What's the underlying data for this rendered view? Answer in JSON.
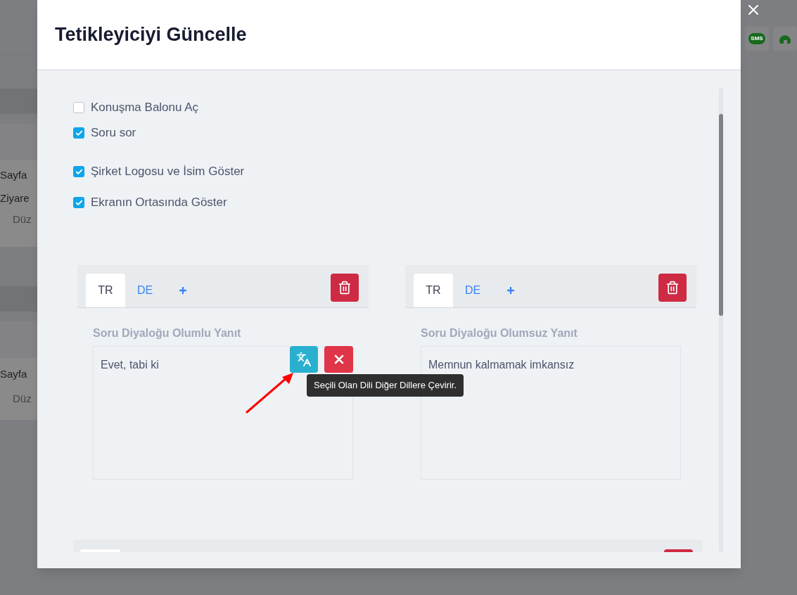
{
  "background": {
    "left_texts": [
      "Sayfa",
      "Ziyare",
      "Düz",
      "Sayfa",
      "Düz"
    ],
    "sms_label": "SMS"
  },
  "modal": {
    "title": "Tetikleyiciyi Güncelle"
  },
  "options": [
    {
      "label": "Konuşma Balonu Aç",
      "checked": false
    },
    {
      "label": "Soru sor",
      "checked": true
    },
    {
      "label": "Şirket Logosu ve İsim Göster",
      "checked": true
    },
    {
      "label": "Ekranın Ortasında Göster",
      "checked": true
    }
  ],
  "answer_panels": [
    {
      "tabs": [
        {
          "label": "TR",
          "selected": true
        },
        {
          "label": "DE",
          "selected": false
        }
      ],
      "field_label": "Soru Diyaloğu Olumlu Yanıt",
      "value": "Evet, tabi ki",
      "show_actions": true
    },
    {
      "tabs": [
        {
          "label": "TR",
          "selected": true
        },
        {
          "label": "DE",
          "selected": false
        }
      ],
      "field_label": "Soru Diyaloğu Olumsuz Yanıt",
      "value": "Memnun kalmamak imkansız",
      "show_actions": false
    }
  ],
  "tooltip": "Seçili Olan Dili Diğer Dillere Çevirir."
}
